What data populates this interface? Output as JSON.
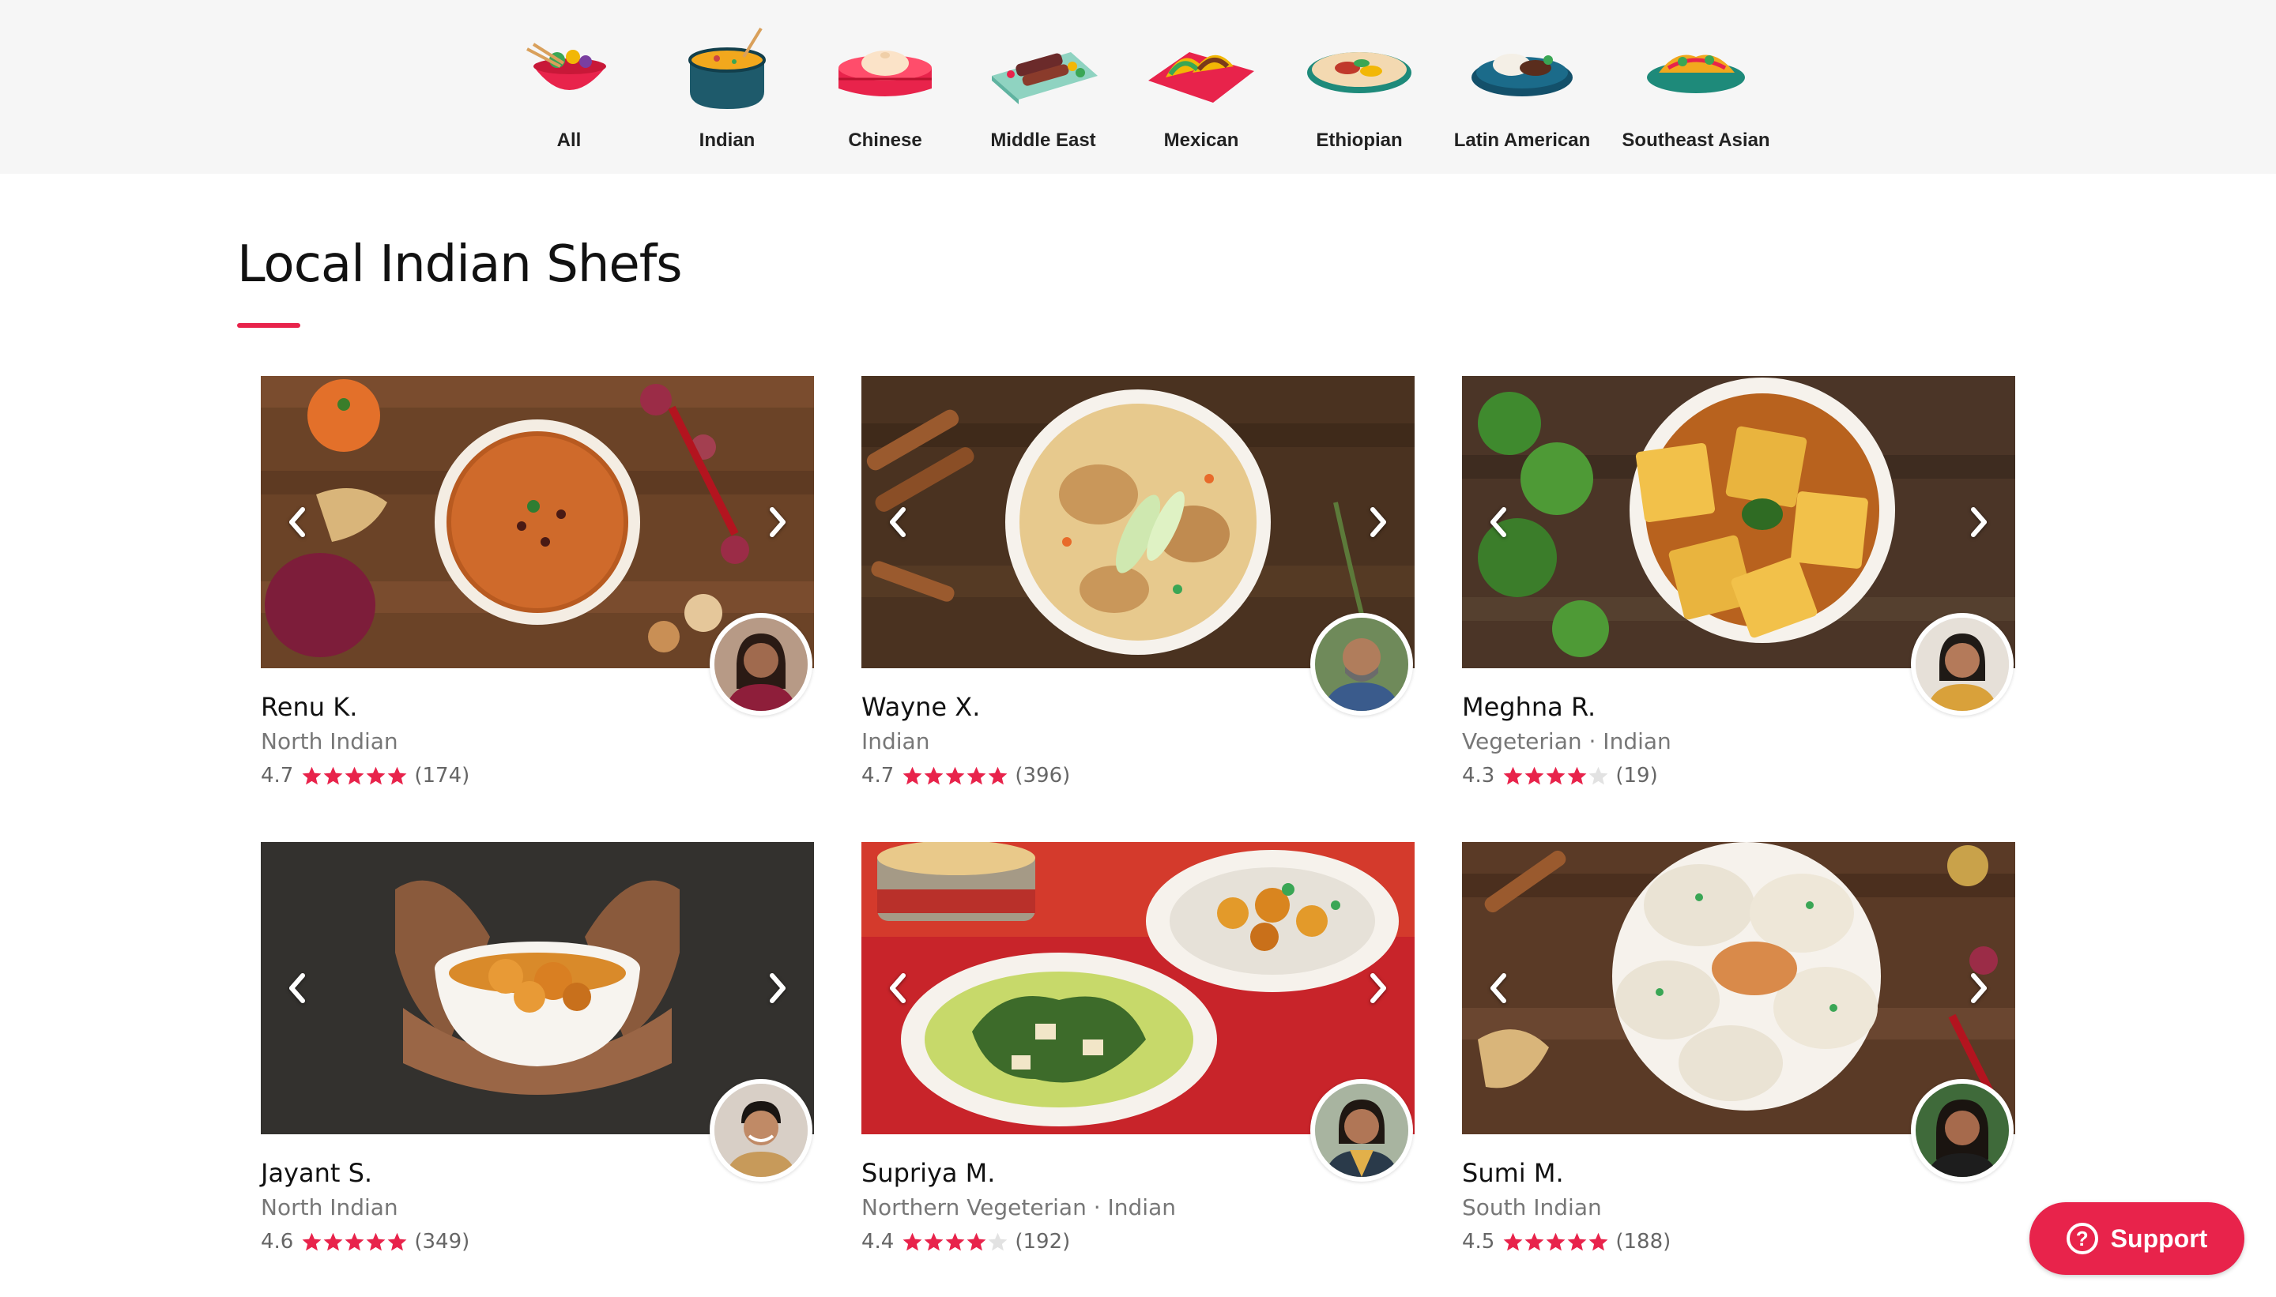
{
  "categories": [
    {
      "label": "All",
      "icon": "mixed-bowl-icon"
    },
    {
      "label": "Indian",
      "icon": "curry-pot-icon"
    },
    {
      "label": "Chinese",
      "icon": "dumpling-steamer-icon"
    },
    {
      "label": "Middle East",
      "icon": "kebab-plate-icon"
    },
    {
      "label": "Mexican",
      "icon": "taco-plate-icon"
    },
    {
      "label": "Ethiopian",
      "icon": "injera-plate-icon"
    },
    {
      "label": "Latin American",
      "icon": "latin-plate-icon"
    },
    {
      "label": "Southeast Asian",
      "icon": "noodle-plate-icon"
    }
  ],
  "section": {
    "title": "Local Indian Shefs"
  },
  "chefs": [
    {
      "name": "Renu K.",
      "cuisine": "North Indian",
      "rating": "4.7",
      "rating_value": 4.7,
      "reviews": "(174)"
    },
    {
      "name": "Wayne X.",
      "cuisine": "Indian",
      "rating": "4.7",
      "rating_value": 4.7,
      "reviews": "(396)"
    },
    {
      "name": "Meghna R.",
      "cuisine": "Vegeterian · Indian",
      "rating": "4.3",
      "rating_value": 4.3,
      "reviews": "(19)"
    },
    {
      "name": "Jayant S.",
      "cuisine": "North Indian",
      "rating": "4.6",
      "rating_value": 4.6,
      "reviews": "(349)"
    },
    {
      "name": "Supriya M.",
      "cuisine": "Northern Vegeterian · Indian",
      "rating": "4.4",
      "rating_value": 4.4,
      "reviews": "(192)"
    },
    {
      "name": "Sumi M.",
      "cuisine": "South Indian",
      "rating": "4.5",
      "rating_value": 4.5,
      "reviews": "(188)"
    }
  ],
  "support": {
    "label": "Support",
    "icon": "question-circle-icon"
  },
  "colors": {
    "accent": "#e8234b",
    "topbar": "#f6f6f6",
    "star_empty": "#e2e2e2"
  }
}
